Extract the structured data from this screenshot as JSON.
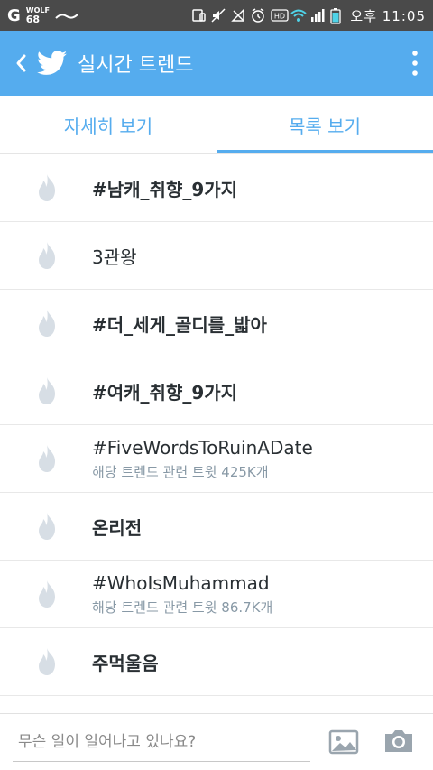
{
  "status_bar": {
    "carrier_logo": "G",
    "weather_label": "WOLF",
    "temperature": "68",
    "time": "오후 11:05",
    "icons": [
      "screen-icon",
      "mute-icon",
      "no-signal-icon",
      "alarm-icon",
      "hd-icon",
      "wifi-icon",
      "signal-icon",
      "battery-icon"
    ]
  },
  "app_bar": {
    "title": "실시간 트렌드",
    "brand_color": "#55acee"
  },
  "tabs": [
    {
      "label": "자세히 보기",
      "active": false
    },
    {
      "label": "목록 보기",
      "active": true
    }
  ],
  "trends": [
    {
      "name": "#남캐_취향_9가지",
      "subtitle": ""
    },
    {
      "name": "3관왕",
      "subtitle": ""
    },
    {
      "name": "#더_세게_골디를_밟아",
      "subtitle": ""
    },
    {
      "name": "#여캐_취향_9가지",
      "subtitle": ""
    },
    {
      "name": "#FiveWordsToRuinADate",
      "subtitle": "해당 트렌드 관련 트윗 425K개"
    },
    {
      "name": "온리전",
      "subtitle": ""
    },
    {
      "name": "#WhoIsMuhammad",
      "subtitle": "해당 트렌드 관련 트윗 86.7K개"
    },
    {
      "name": "주먹울음",
      "subtitle": ""
    }
  ],
  "compose": {
    "placeholder": "무슨 일이 일어나고 있나요?"
  }
}
